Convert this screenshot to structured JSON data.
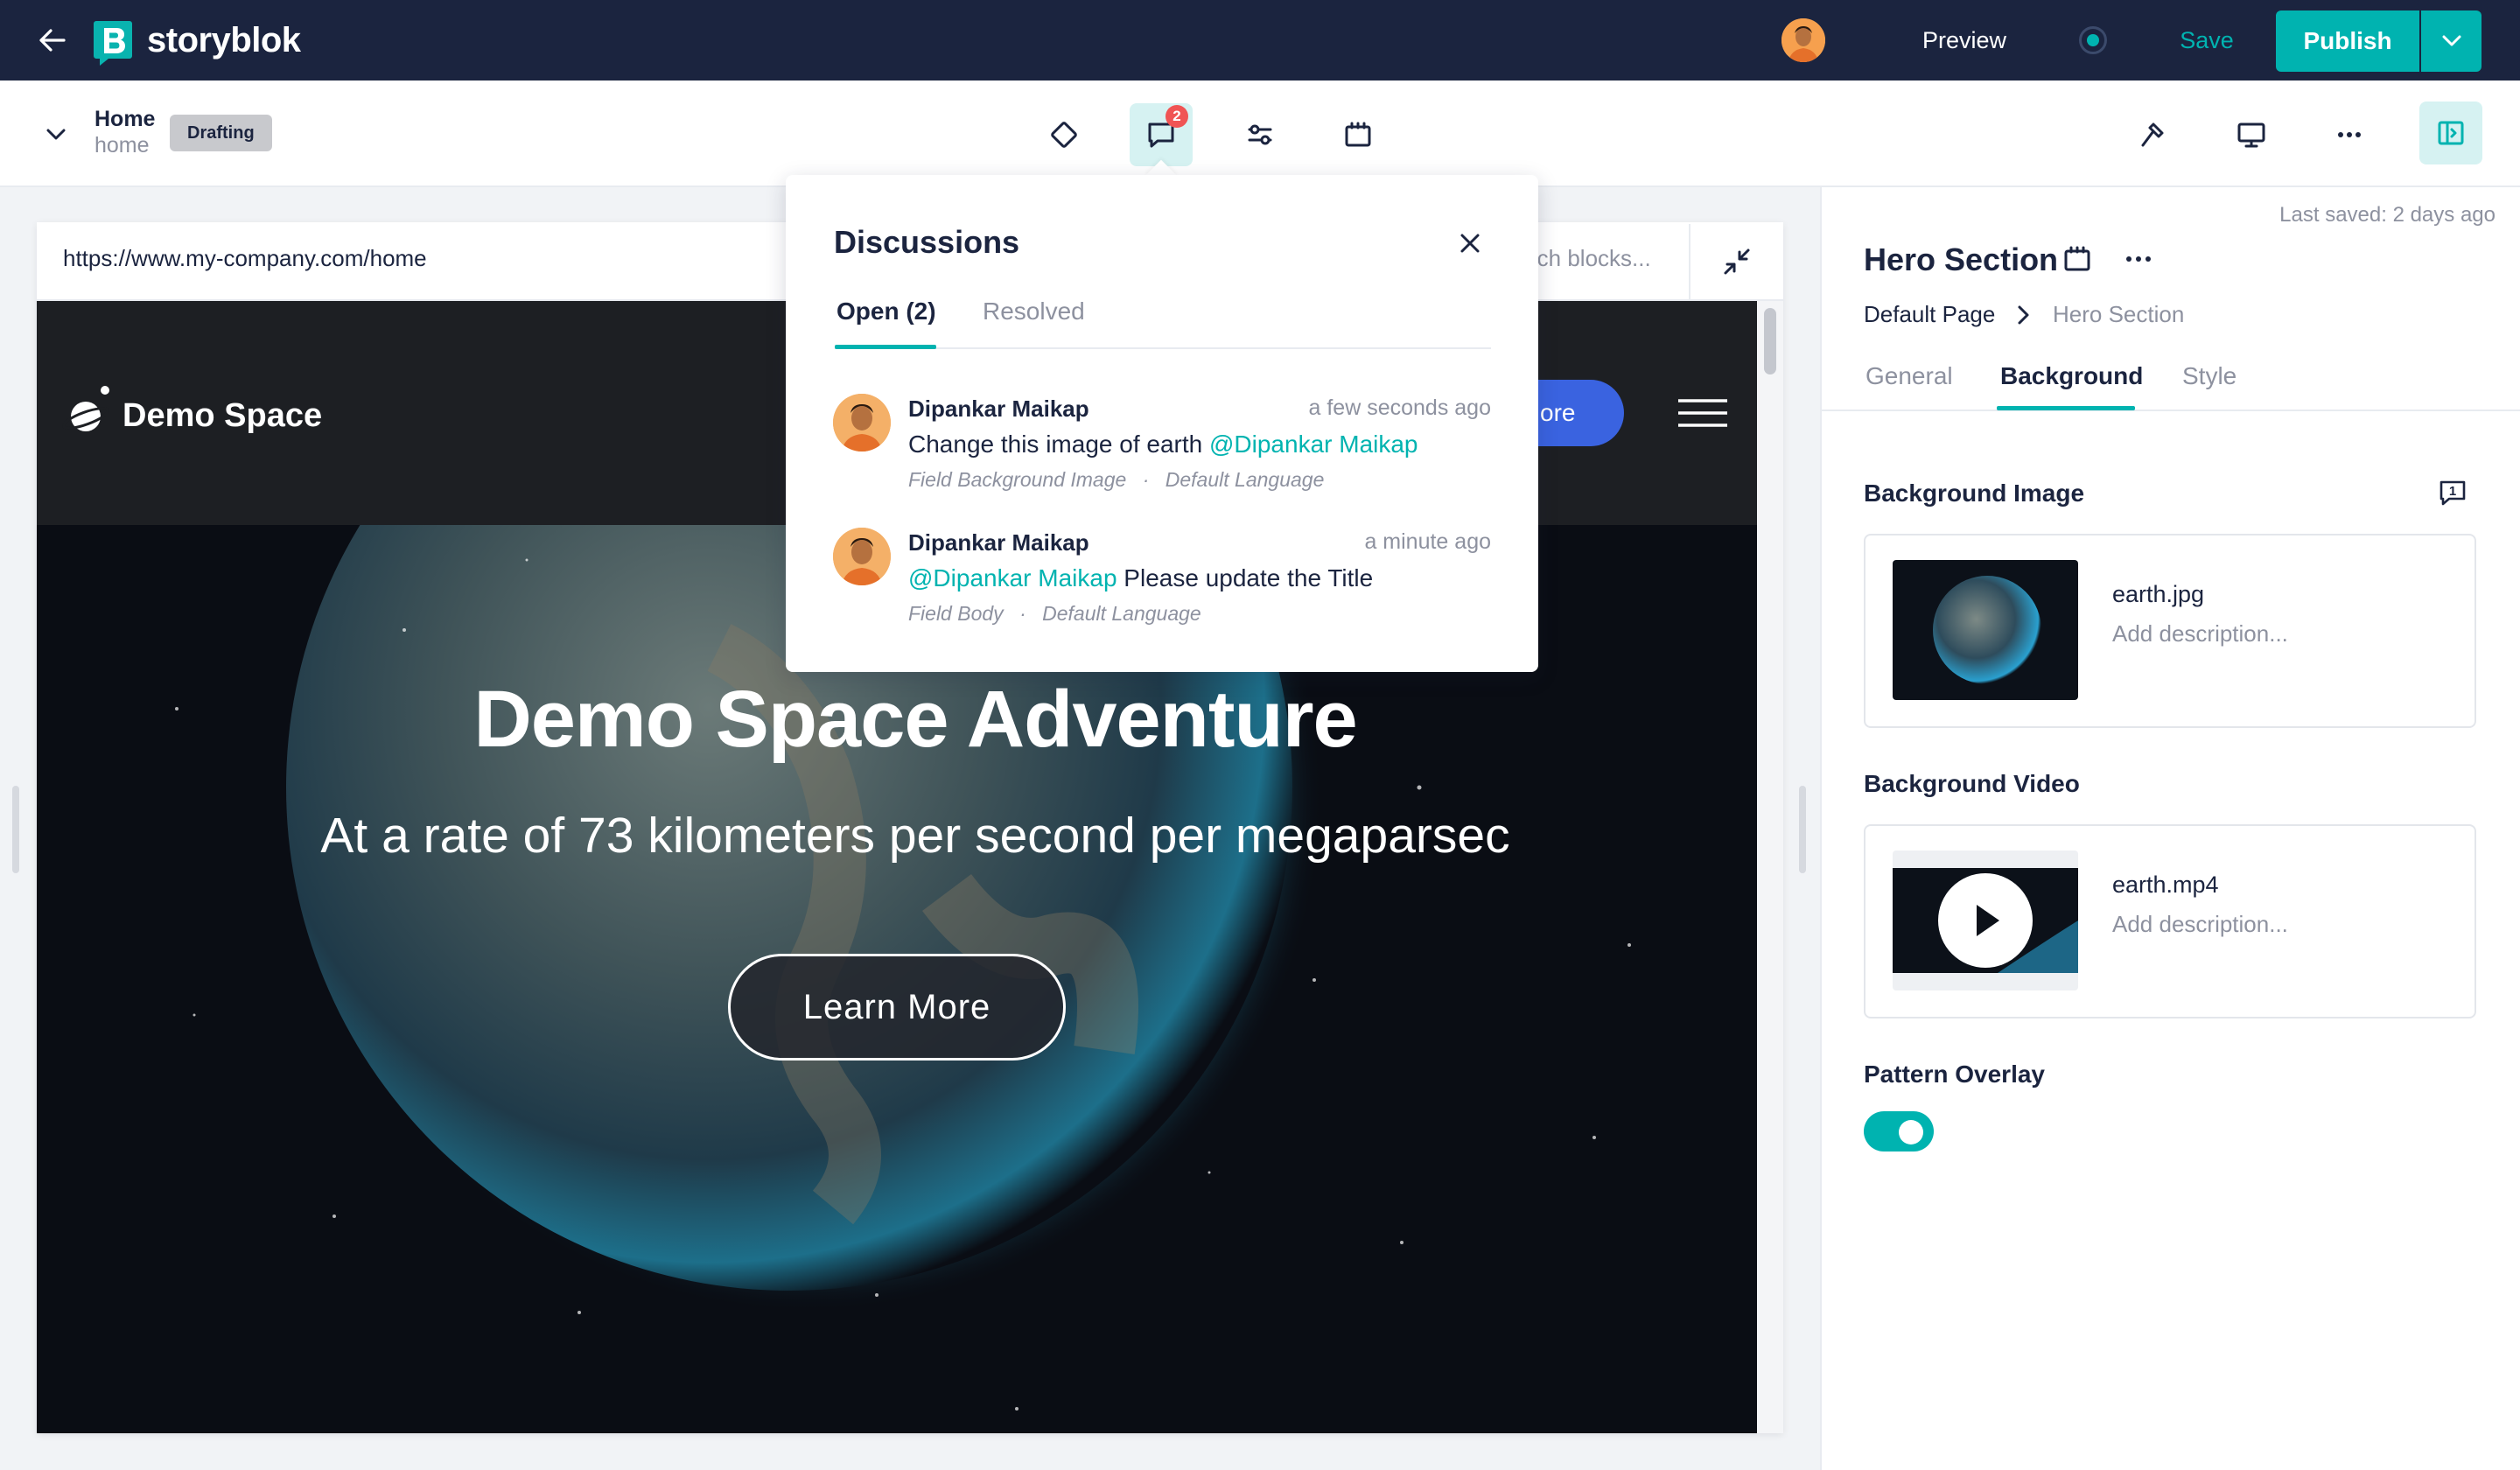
{
  "app": {
    "name": "storyblok"
  },
  "topbar": {
    "preview_label": "Preview",
    "save_label": "Save",
    "publish_label": "Publish"
  },
  "story": {
    "name": "Home",
    "slug": "home",
    "status": "Drafting"
  },
  "toolbar": {
    "comments_count": "2"
  },
  "preview": {
    "url": "https://www.my-company.com/home",
    "search_placeholder": "rch blocks...",
    "site": {
      "brand": "Demo Space",
      "cta_fragment": "ore",
      "hero_title": "Demo Space Adventure",
      "hero_subtitle": "At a rate of 73 kilometers per second per megaparsec",
      "hero_button": "Learn More"
    }
  },
  "discussions": {
    "title": "Discussions",
    "tabs": {
      "open": "Open (2)",
      "resolved": "Resolved"
    },
    "comments": [
      {
        "author": "Dipankar Maikap",
        "time": "a few seconds ago",
        "text_before": "Change this image of earth ",
        "mention": "@Dipankar Maikap",
        "text_after": "",
        "field": "Field Background Image",
        "language": "Default Language"
      },
      {
        "author": "Dipankar Maikap",
        "time": "a minute ago",
        "text_before": "",
        "mention": "@Dipankar Maikap",
        "text_after": " Please update the Title",
        "field": "Field Body",
        "language": "Default Language"
      }
    ]
  },
  "panel": {
    "last_saved": "Last saved: 2 days ago",
    "block_title": "Hero Section",
    "breadcrumb": [
      "Default Page",
      "Hero Section"
    ],
    "tabs": [
      "General",
      "Background",
      "Style"
    ],
    "active_tab": "Background",
    "fields": {
      "background_image": {
        "label": "Background Image",
        "comment_count": "1",
        "filename": "earth.jpg",
        "description_placeholder": "Add description..."
      },
      "background_video": {
        "label": "Background Video",
        "filename": "earth.mp4",
        "description_placeholder": "Add description..."
      },
      "pattern_overlay": {
        "label": "Pattern Overlay",
        "enabled": true
      }
    }
  },
  "colors": {
    "navy": "#1b243f",
    "teal": "#00b3b0",
    "badge_red": "#f05454",
    "site_button_blue": "#3a63e0"
  }
}
